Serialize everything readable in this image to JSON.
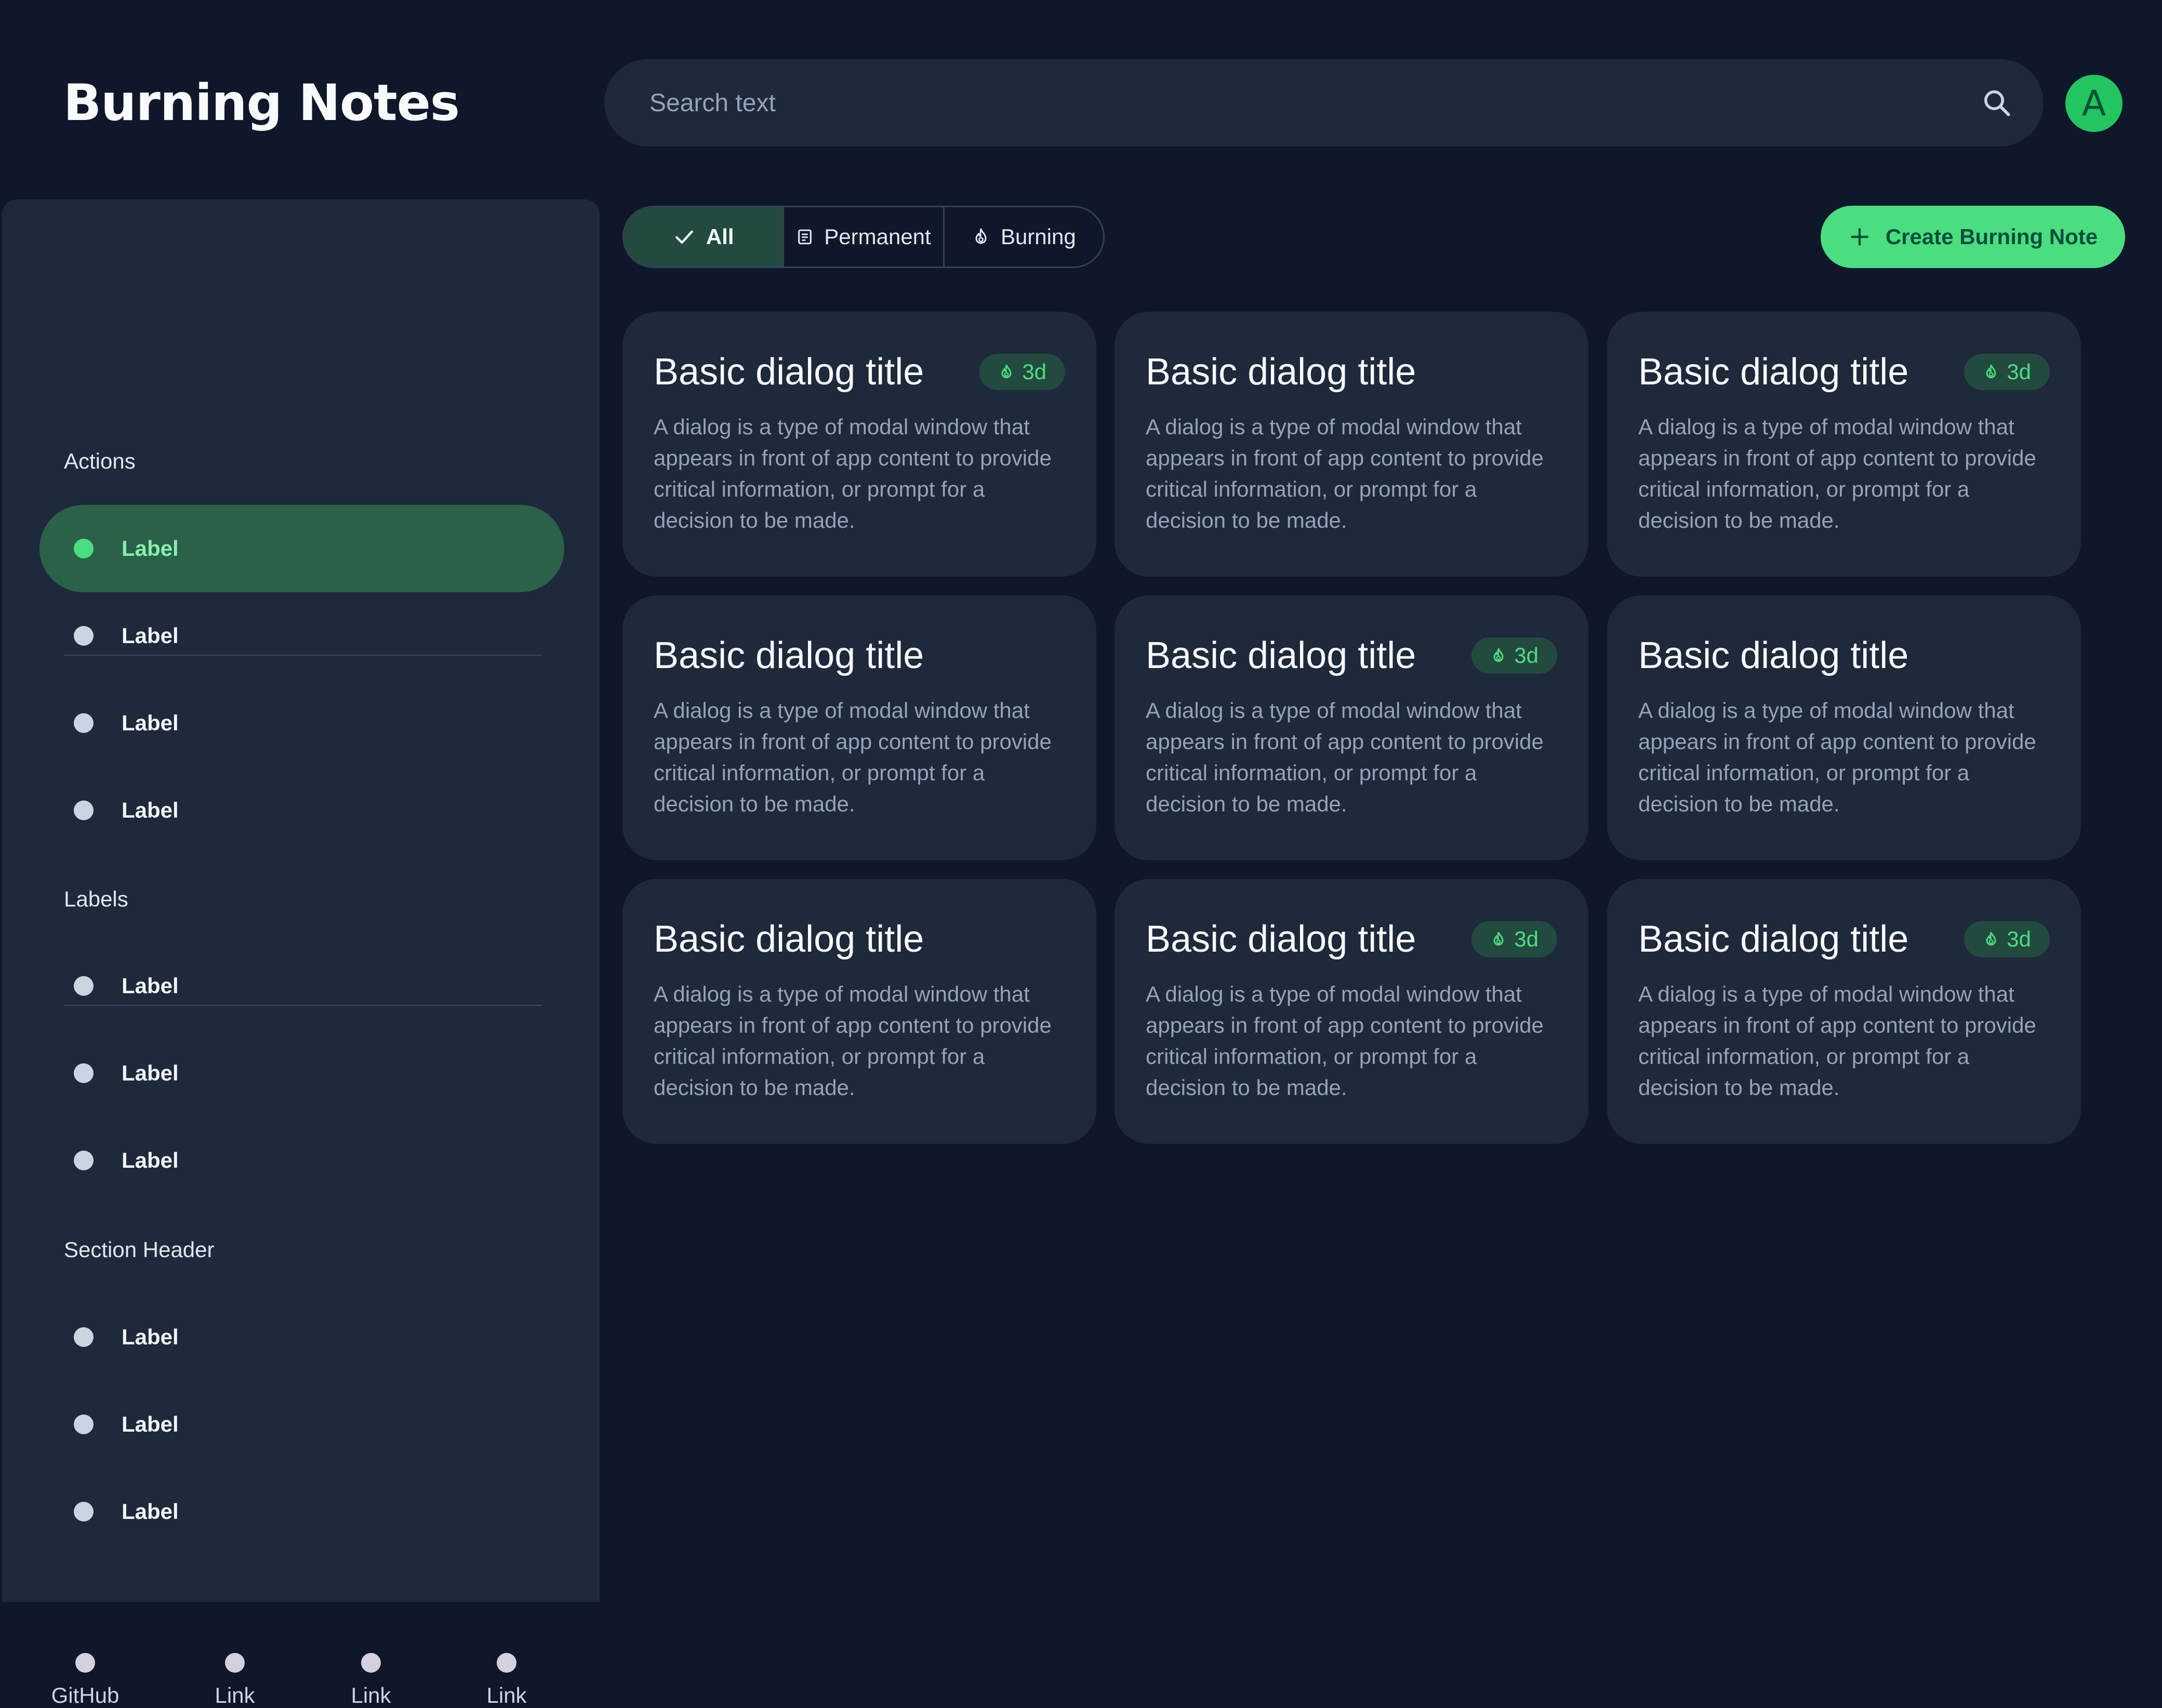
{
  "app": {
    "title": "Burning Notes"
  },
  "search": {
    "placeholder": "Search text",
    "icon": "search-icon"
  },
  "avatar": {
    "initial": "A",
    "color": "#22c55e"
  },
  "sidebar": {
    "sections": [
      {
        "header": "Actions",
        "items": [
          {
            "label": "Label",
            "active": true
          },
          {
            "label": "Label"
          },
          {
            "label": "Label"
          },
          {
            "label": "Label"
          }
        ]
      },
      {
        "header": "Labels",
        "items": [
          {
            "label": "Label"
          },
          {
            "label": "Label"
          },
          {
            "label": "Label"
          }
        ]
      },
      {
        "header": "Section Header",
        "items": [
          {
            "label": "Label"
          },
          {
            "label": "Label"
          },
          {
            "label": "Label"
          }
        ]
      }
    ],
    "footer_links": [
      "GitHub",
      "Link",
      "Link",
      "Link"
    ]
  },
  "filters": {
    "options": [
      {
        "label": "All",
        "icon": "check-icon",
        "selected": true
      },
      {
        "label": "Permanent",
        "icon": "document-icon"
      },
      {
        "label": "Burning",
        "icon": "flame-icon"
      }
    ]
  },
  "create_button": {
    "label": "Create Burning Note",
    "icon": "plus-icon"
  },
  "cards": [
    {
      "title": "Basic dialog title",
      "badge": "3d",
      "body": "A dialog is a type of modal window that appears in front of app content to provide critical information, or prompt for a decision to be made."
    },
    {
      "title": "Basic dialog title",
      "badge": null,
      "body": "A dialog is a type of modal window that appears in front of app content to provide critical information, or prompt for a decision to be made."
    },
    {
      "title": "Basic dialog title",
      "badge": "3d",
      "body": "A dialog is a type of modal window that appears in front of app content to provide critical information, or prompt for a decision to be made."
    },
    {
      "title": "Basic dialog title",
      "badge": null,
      "body": "A dialog is a type of modal window that appears in front of app content to provide critical information, or prompt for a decision to be made."
    },
    {
      "title": "Basic dialog title",
      "badge": "3d",
      "body": "A dialog is a type of modal window that appears in front of app content to provide critical information, or prompt for a decision to be made."
    },
    {
      "title": "Basic dialog title",
      "badge": null,
      "body": "A dialog is a type of modal window that appears in front of app content to provide critical information, or prompt for a decision to be made."
    },
    {
      "title": "Basic dialog title",
      "badge": null,
      "body": "A dialog is a type of modal window that appears in front of app content to provide critical information, or prompt for a decision to be made."
    },
    {
      "title": "Basic dialog title",
      "badge": "3d",
      "body": "A dialog is a type of modal window that appears in front of app content to provide critical information, or prompt for a decision to be made."
    },
    {
      "title": "Basic dialog title",
      "badge": "3d",
      "body": "A dialog is a type of modal window that appears in front of app content to provide critical information, or prompt for a decision to be made."
    }
  ],
  "colors": {
    "background": "#0f172a",
    "surface": "#1e293b",
    "accent": "#4ade80",
    "accent_dark": "#234a3f"
  }
}
